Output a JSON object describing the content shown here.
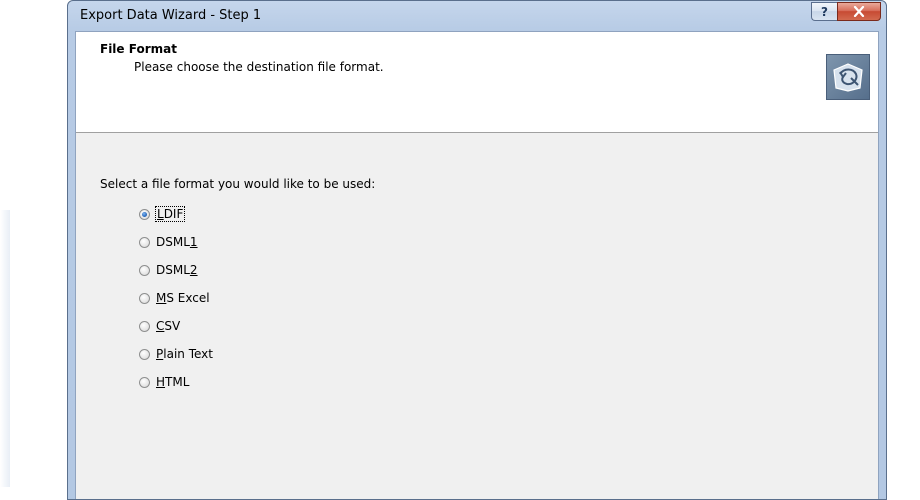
{
  "window": {
    "title": "Export Data Wizard - Step 1",
    "help_label": "?",
    "close_label": "X"
  },
  "header": {
    "title": "File Format",
    "subtitle": "Please choose the destination file format."
  },
  "body": {
    "prompt": "Select a file format you would like to be used:"
  },
  "formats": [
    {
      "mnemonic": "L",
      "rest": "DIF",
      "pre": "",
      "checked": true
    },
    {
      "pre": "DSML",
      "mnemonic": "1",
      "rest": "",
      "checked": false
    },
    {
      "pre": "DSML",
      "mnemonic": "2",
      "rest": "",
      "checked": false
    },
    {
      "pre": "",
      "mnemonic": "M",
      "rest": "S Excel",
      "checked": false
    },
    {
      "pre": "",
      "mnemonic": "C",
      "rest": "SV",
      "checked": false
    },
    {
      "pre": "",
      "mnemonic": "P",
      "rest": "lain Text",
      "checked": false
    },
    {
      "pre": "",
      "mnemonic": "H",
      "rest": "TML",
      "checked": false
    }
  ],
  "colors": {
    "frame": "#b7cbe5",
    "close_button": "#c74a33",
    "body_background": "#f0f0f0"
  },
  "icons": {
    "help": "help-icon",
    "close": "close-icon",
    "wizard": "wizard-logo-icon"
  }
}
